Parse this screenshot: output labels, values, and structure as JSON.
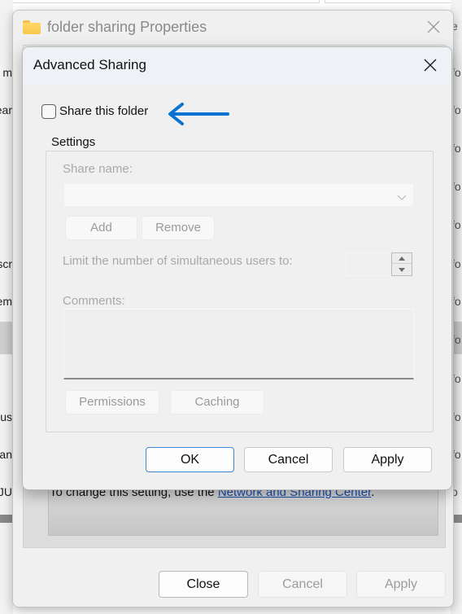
{
  "background": {
    "left_fragments": [
      "m",
      "ear",
      "scr",
      "em",
      "us",
      "an",
      "IJU"
    ],
    "right_fragments": [
      "e",
      "fo",
      "fo",
      "fo",
      "fo",
      "fo",
      "fo",
      "fo",
      "fo",
      "fo",
      "fo",
      "fo",
      "o"
    ]
  },
  "properties_dialog": {
    "title": "folder sharing Properties",
    "icon": "folder-icon",
    "close_icon": "close-icon",
    "info_text_before": "To change this setting, use the ",
    "info_link": "Network and Sharing Center",
    "info_text_after": ".",
    "buttons": {
      "close": "Close",
      "cancel": "Cancel",
      "apply": "Apply"
    }
  },
  "advanced_sharing": {
    "title": "Advanced Sharing",
    "close_icon": "close-icon",
    "share_checkbox": {
      "label": "Share this folder",
      "checked": false
    },
    "annotation_arrow": {
      "icon": "arrow-left-icon",
      "color": "#0a72d0"
    },
    "settings": {
      "legend": "Settings",
      "share_name_label": "Share name:",
      "share_name_value": "",
      "add_label": "Add",
      "remove_label": "Remove",
      "limit_label": "Limit the number of simultaneous users to:",
      "limit_value": "",
      "comments_label": "Comments:",
      "comments_value": "",
      "permissions_label": "Permissions",
      "caching_label": "Caching"
    },
    "buttons": {
      "ok": "OK",
      "cancel": "Cancel",
      "apply": "Apply"
    }
  },
  "colors": {
    "accent": "#3d87d2",
    "link": "#1a4fb0",
    "arrow": "#0a72d0",
    "disabled_text": "#a9a9a9"
  }
}
